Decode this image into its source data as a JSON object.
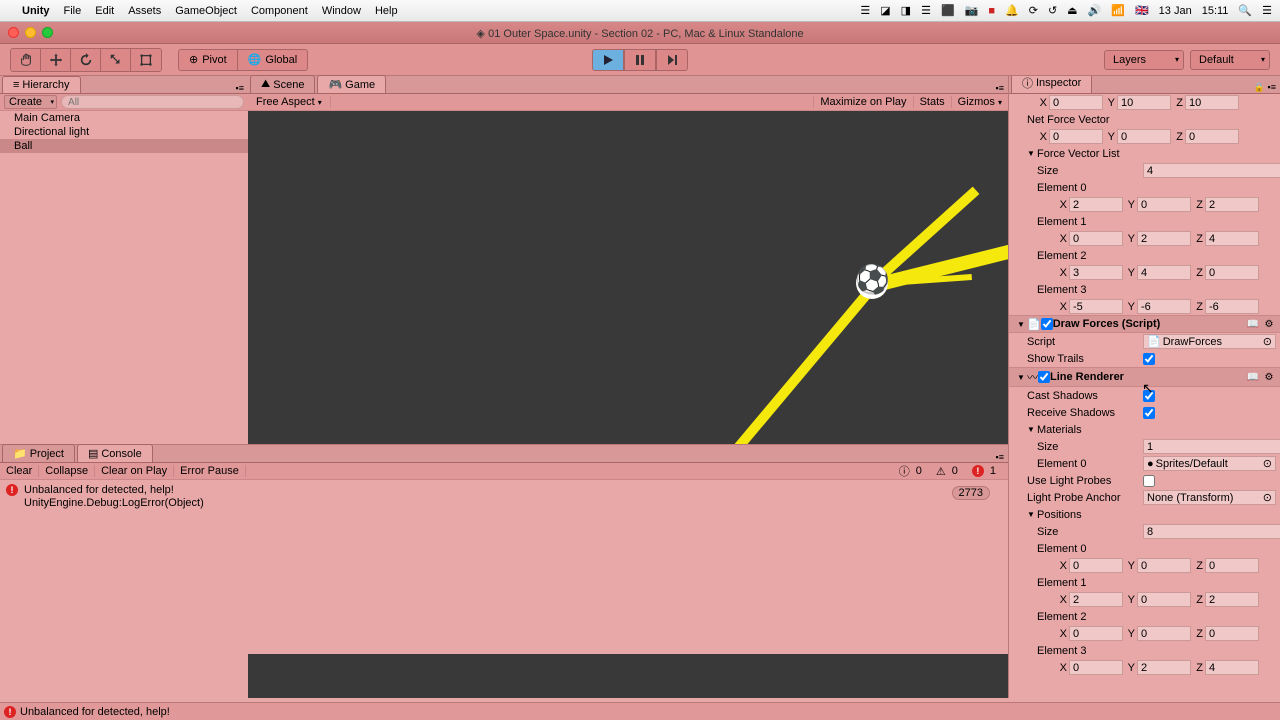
{
  "mac_menu": {
    "app": "Unity",
    "items": [
      "File",
      "Edit",
      "Assets",
      "GameObject",
      "Component",
      "Window",
      "Help"
    ],
    "right": {
      "flag": "🇬🇧",
      "date": "13 Jan",
      "time": "15:11"
    }
  },
  "window": {
    "title": "01 Outer Space.unity - Section 02 - PC, Mac & Linux Standalone",
    "diamond": "◈"
  },
  "toolbar": {
    "pivot": "Pivot",
    "global": "Global",
    "layers": "Layers",
    "layout": "Default"
  },
  "hierarchy": {
    "tab": "Hierarchy",
    "create": "Create",
    "search_placeholder": "All",
    "items": [
      "Main Camera",
      "Directional light",
      "Ball"
    ],
    "selected_index": 2
  },
  "scene_tab": "Scene",
  "game_tab": "Game",
  "game_toolbar": {
    "aspect": "Free Aspect",
    "maximize": "Maximize on Play",
    "stats": "Stats",
    "gizmos": "Gizmos"
  },
  "project_tab": "Project",
  "console_tab": "Console",
  "console": {
    "clear": "Clear",
    "collapse": "Collapse",
    "clear_on_play": "Clear on Play",
    "error_pause": "Error Pause",
    "info_count": "0",
    "warn_count": "0",
    "err_count": "1",
    "entry_line1": "Unbalanced for detected, help!",
    "entry_line2": "UnityEngine.Debug:LogError(Object)",
    "entry_count": "2773"
  },
  "inspector": {
    "tab": "Inspector",
    "top_xyz": {
      "x": "0",
      "y": "10",
      "z": "10"
    },
    "net_force": {
      "label": "Net Force Vector",
      "x": "0",
      "y": "0",
      "z": "0"
    },
    "force_list": {
      "label": "Force Vector List",
      "size_label": "Size",
      "size": "4",
      "elements": [
        {
          "label": "Element 0",
          "x": "2",
          "y": "0",
          "z": "2"
        },
        {
          "label": "Element 1",
          "x": "0",
          "y": "2",
          "z": "4"
        },
        {
          "label": "Element 2",
          "x": "3",
          "y": "4",
          "z": "0"
        },
        {
          "label": "Element 3",
          "x": "-5",
          "y": "-6",
          "z": "-6"
        }
      ]
    },
    "draw_forces": {
      "title": "Draw Forces (Script)",
      "script_label": "Script",
      "script_value": "DrawForces",
      "show_trails": "Show Trails"
    },
    "line_renderer": {
      "title": "Line Renderer",
      "cast_shadows": "Cast Shadows",
      "receive_shadows": "Receive Shadows",
      "materials": "Materials",
      "mat_size_label": "Size",
      "mat_size": "1",
      "mat_elem0_label": "Element 0",
      "mat_elem0_value": "Sprites/Default",
      "use_light_probes": "Use Light Probes",
      "light_probe_anchor": "Light Probe Anchor",
      "light_probe_anchor_value": "None (Transform)",
      "positions": "Positions",
      "pos_size_label": "Size",
      "pos_size": "8",
      "pos_elements": [
        {
          "label": "Element 0",
          "x": "0",
          "y": "0",
          "z": "0"
        },
        {
          "label": "Element 1",
          "x": "2",
          "y": "0",
          "z": "2"
        },
        {
          "label": "Element 2",
          "x": "0",
          "y": "0",
          "z": "0"
        },
        {
          "label": "Element 3",
          "x": "0",
          "y": "2",
          "z": "4"
        }
      ]
    }
  },
  "status": {
    "message": "Unbalanced for detected, help!"
  }
}
